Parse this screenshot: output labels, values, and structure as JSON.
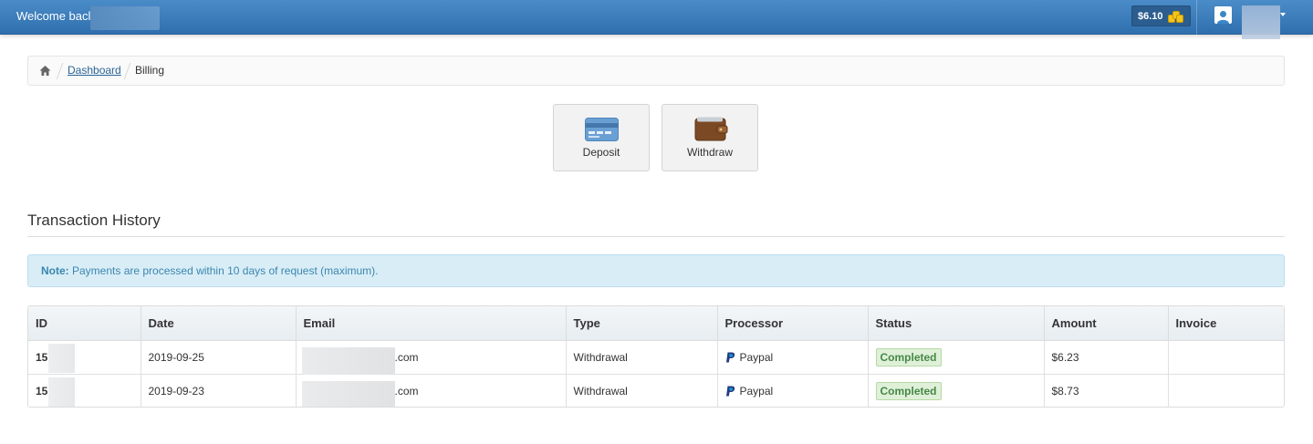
{
  "header": {
    "welcome_text": "Welcome bacl",
    "balance": "$6.10",
    "balance_icon": "coins-icon",
    "user_icon": "user-icon"
  },
  "breadcrumb": {
    "home_icon": "home-icon",
    "items": [
      {
        "label": "Dashboard"
      },
      {
        "label": "Billing"
      }
    ]
  },
  "actions": {
    "deposit": {
      "label": "Deposit",
      "icon": "credit-card-icon"
    },
    "withdraw": {
      "label": "Withdraw",
      "icon": "wallet-icon"
    }
  },
  "history": {
    "title": "Transaction History",
    "note_label": "Note:",
    "note_text": " Payments are processed within 10 days of request (maximum)."
  },
  "table": {
    "columns": [
      "ID",
      "Date",
      "Email",
      "Type",
      "Processor",
      "Status",
      "Amount",
      "Invoice"
    ],
    "rows": [
      {
        "id": "15",
        "date": "2019-09-25",
        "email_suffix": ".com",
        "type": "Withdrawal",
        "processor": "Paypal",
        "status": "Completed",
        "amount": "$6.23",
        "invoice": ""
      },
      {
        "id": "15",
        "date": "2019-09-23",
        "email_suffix": ".com",
        "type": "Withdrawal",
        "processor": "Paypal",
        "status": "Completed",
        "amount": "$8.73",
        "invoice": ""
      }
    ]
  },
  "colors": {
    "topbar": "#3a7dbf",
    "note_bg": "#d9edf7",
    "note_text": "#3a87ad",
    "status_bg": "#dff0d8",
    "status_text": "#468847",
    "link": "#2a6496"
  }
}
